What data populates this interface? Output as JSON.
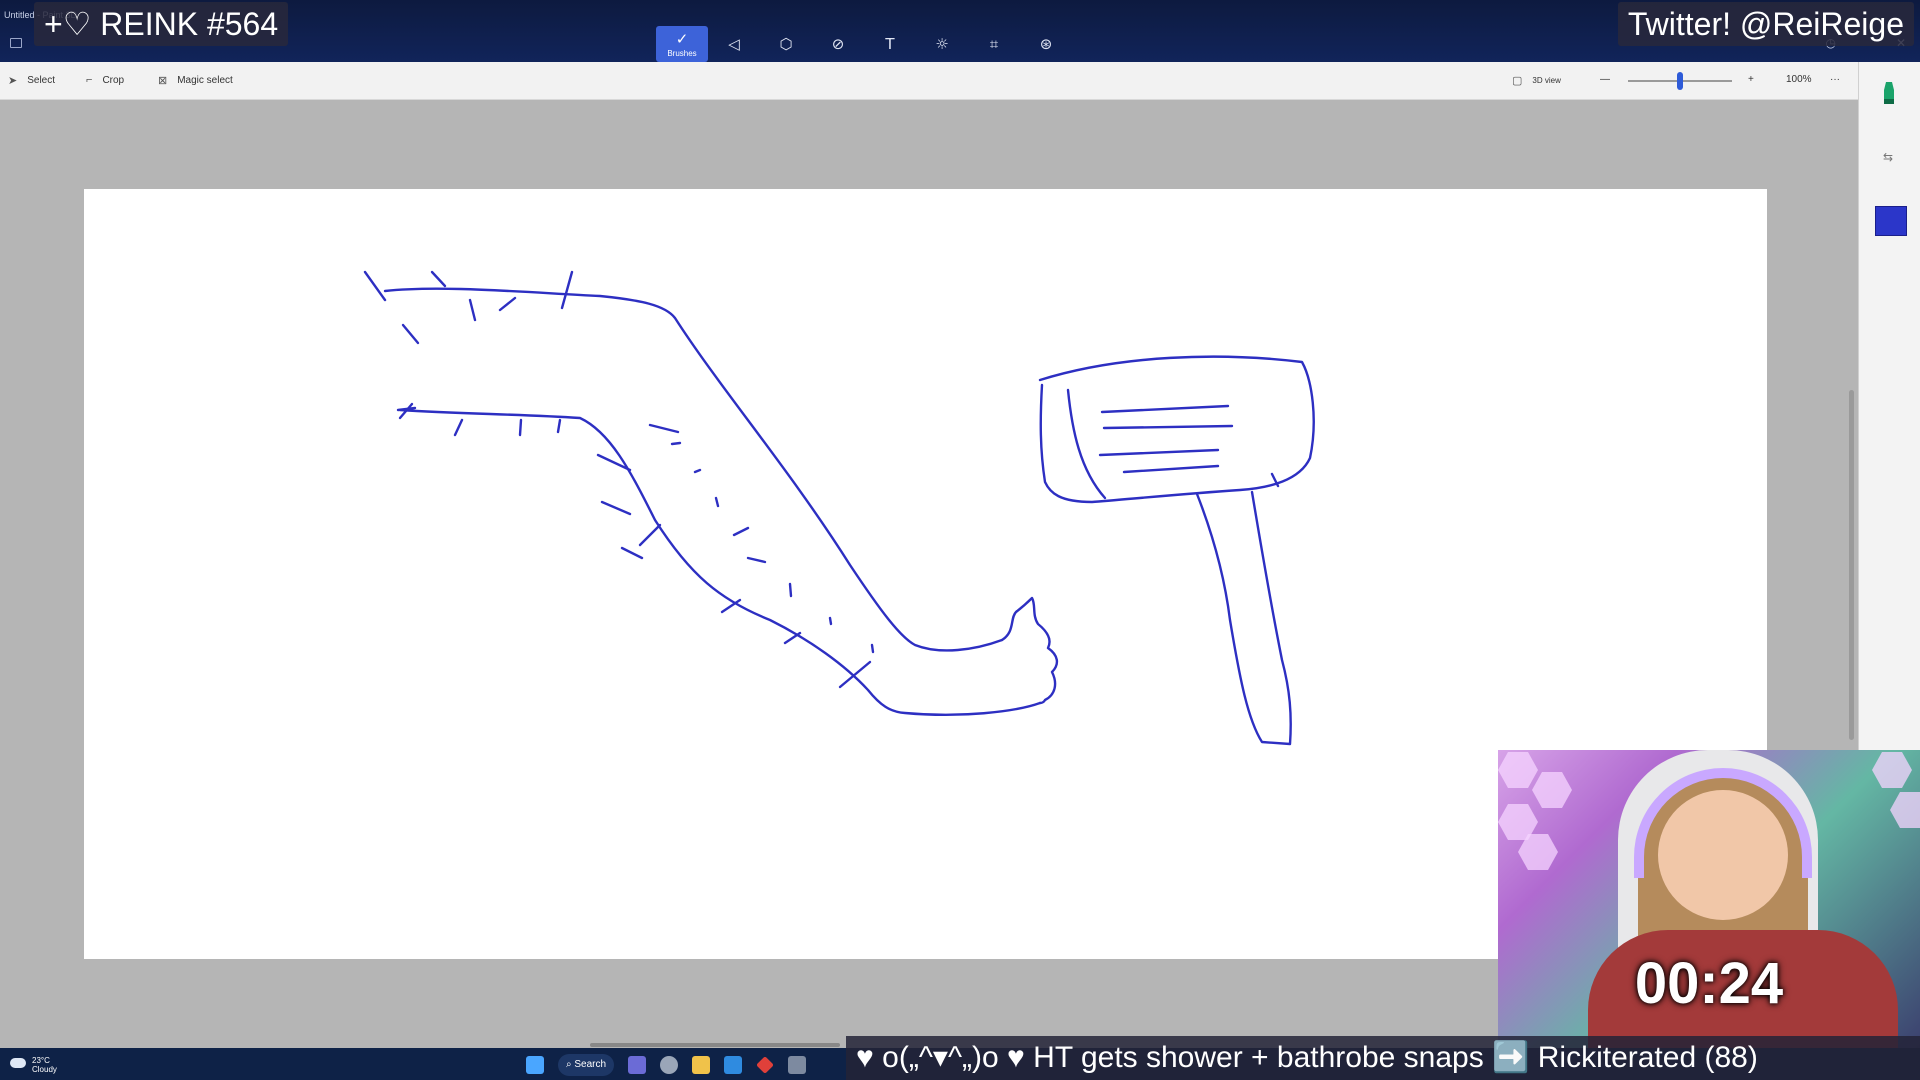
{
  "window": {
    "title": "Untitled - Paint 3D"
  },
  "overlay": {
    "stream_title": "+♡ REINK #564",
    "twitter": "Twitter! @ReiReige",
    "timer": "00:24",
    "ticker": "♥ o(„^▾^„)o ♥ HT gets shower + bathrobe snaps ➡️ Rickiterated (88)"
  },
  "toolbar": {
    "active_tool_label": "Brushes",
    "tools": [
      "brushes-icon",
      "2d-shapes-icon",
      "3d-shapes-icon",
      "stickers-icon",
      "text-icon",
      "effects-icon",
      "canvas-icon",
      "3d-library-icon"
    ]
  },
  "subbar": {
    "select": "Select",
    "crop": "Crop",
    "magic_select": "Magic select",
    "view_3d": "3D view",
    "zoom": "100%",
    "zoom_level": 0.5,
    "more": "···"
  },
  "right_panel": {
    "brush_icon": "marker-icon",
    "color": "#2b36c9"
  },
  "taskbar": {
    "temperature": "23°C",
    "condition": "Cloudy",
    "search": "Search"
  },
  "colors": {
    "ink": "#2d2fc2",
    "accent": "#3d63d9",
    "titlebar": "#0d1a3f"
  }
}
